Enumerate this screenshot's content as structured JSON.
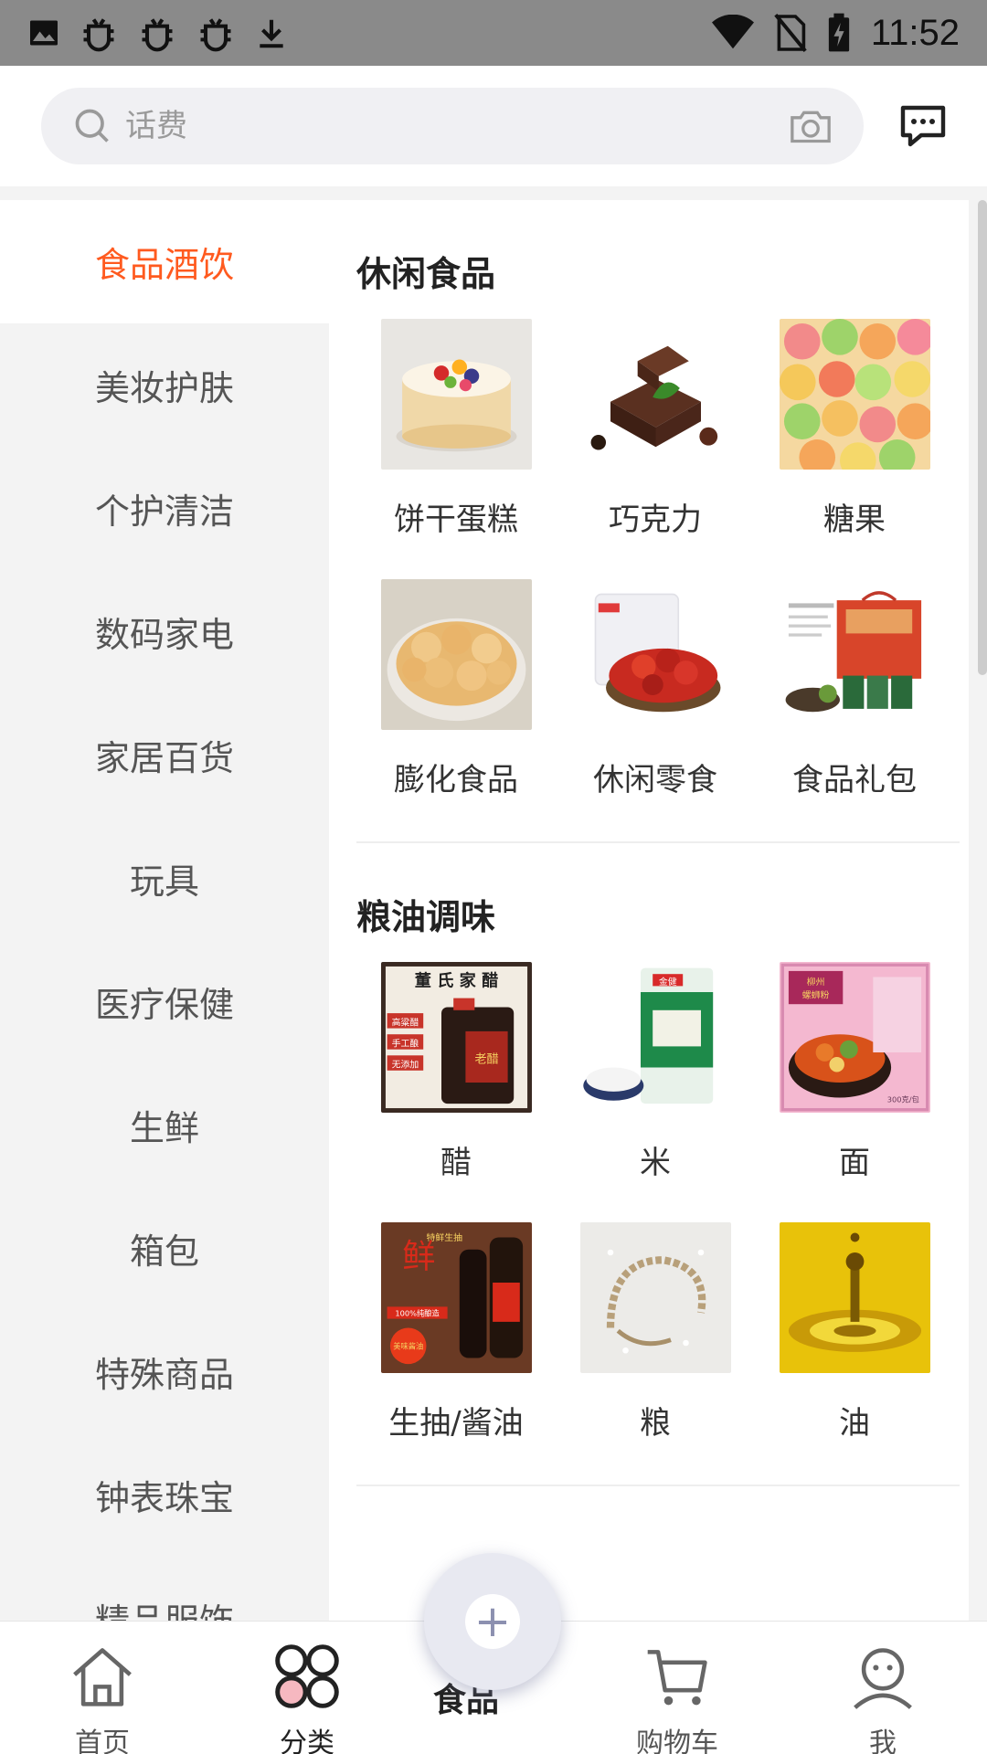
{
  "status_bar": {
    "time": "11:52",
    "icons": [
      "image-icon",
      "bug-icon",
      "bug-icon",
      "bug-icon",
      "download-icon",
      "wifi-icon",
      "no-sim-icon",
      "battery-charging-icon"
    ]
  },
  "search": {
    "placeholder": "话费"
  },
  "sidebar": {
    "items": [
      {
        "label": "食品酒饮",
        "active": true
      },
      {
        "label": "美妆护肤"
      },
      {
        "label": "个护清洁"
      },
      {
        "label": "数码家电"
      },
      {
        "label": "家居百货"
      },
      {
        "label": "玩具"
      },
      {
        "label": "医疗保健"
      },
      {
        "label": "生鲜"
      },
      {
        "label": "箱包"
      },
      {
        "label": "特殊商品"
      },
      {
        "label": "钟表珠宝"
      },
      {
        "label": "精品服饰"
      }
    ]
  },
  "sections": [
    {
      "title": "休闲食品",
      "items": [
        {
          "label": "饼干蛋糕",
          "image": "cake-image"
        },
        {
          "label": "巧克力",
          "image": "chocolate-image"
        },
        {
          "label": "糖果",
          "image": "candy-image"
        },
        {
          "label": "膨化食品",
          "image": "crackers-image"
        },
        {
          "label": "休闲零食",
          "image": "dried-fruit-image"
        },
        {
          "label": "食品礼包",
          "image": "gift-box-image"
        }
      ]
    },
    {
      "title": "粮油调味",
      "items": [
        {
          "label": "醋",
          "image": "vinegar-image",
          "image_text": [
            "董 氏 家 醋",
            "高粱醋",
            "手工酿",
            "无添加",
            "老醋"
          ]
        },
        {
          "label": "米",
          "image": "rice-bag-image",
          "image_text": [
            "金健"
          ]
        },
        {
          "label": "面",
          "image": "noodles-image",
          "image_text": [
            "柳州",
            "螺蛳粉",
            "300克/包"
          ]
        },
        {
          "label": "生抽/酱油",
          "image": "soy-sauce-image",
          "image_text": [
            "鲜",
            "特鲜生抽",
            "100%纯酿造",
            "美味酱油"
          ]
        },
        {
          "label": "粮",
          "image": "grain-image"
        },
        {
          "label": "油",
          "image": "oil-image"
        }
      ]
    }
  ],
  "tabbar": {
    "items": [
      {
        "label": "首页",
        "icon": "home-icon"
      },
      {
        "label": "分类",
        "icon": "category-icon",
        "active": true
      },
      {
        "label": "食品",
        "icon": "plus-icon"
      },
      {
        "label": "购物车",
        "icon": "cart-icon"
      },
      {
        "label": "我",
        "icon": "profile-icon"
      }
    ]
  },
  "colors": {
    "accent": "#ff5a1f",
    "status_bar": "#8a8a8a",
    "sidebar_bg": "#f3f3f3"
  }
}
